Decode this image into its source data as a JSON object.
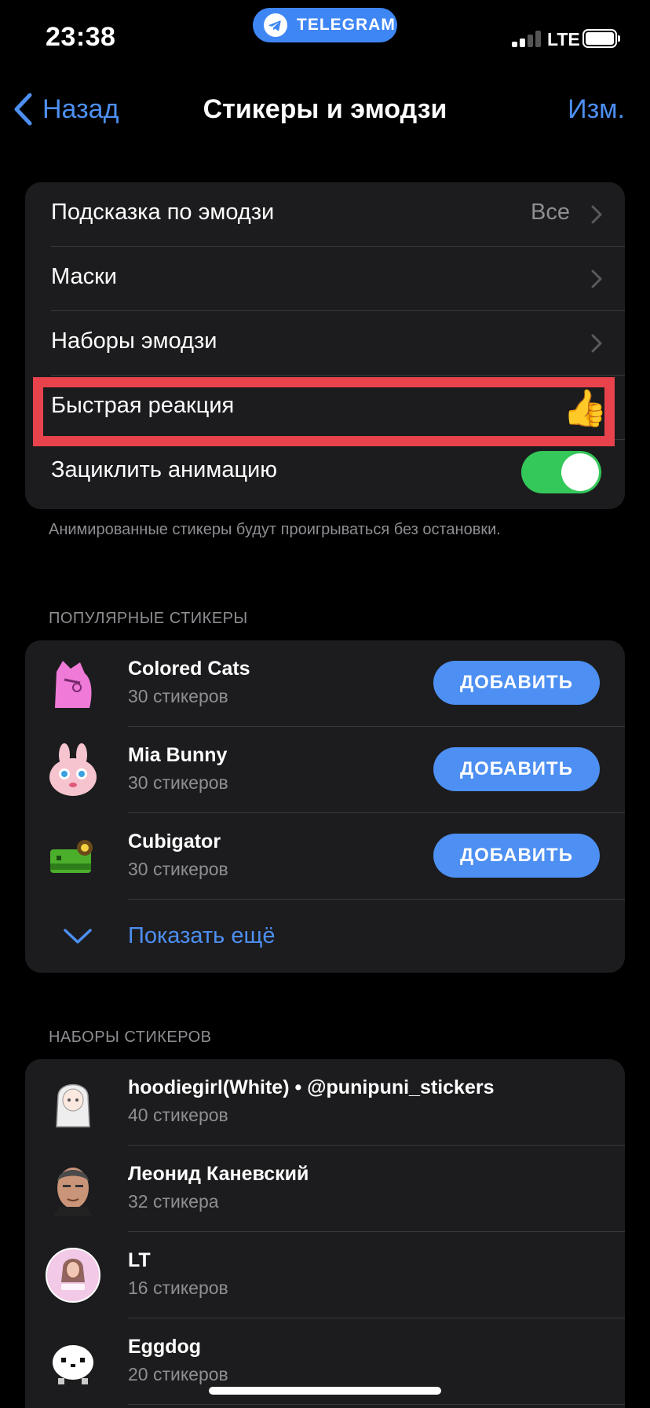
{
  "status_bar": {
    "time": "23:38",
    "carrier_pill": "TELEGRAM",
    "network": "LTE"
  },
  "nav": {
    "back_label": "Назад",
    "title": "Стикеры и эмодзи",
    "edit_label": "Изм."
  },
  "settings": {
    "rows": [
      {
        "label": "Подсказка по эмодзи",
        "value": "Все"
      },
      {
        "label": "Маски"
      },
      {
        "label": "Наборы эмодзи"
      },
      {
        "label": "Быстрая реакция",
        "emoji": "👍"
      },
      {
        "label": "Зациклить анимацию",
        "toggle_on": true
      }
    ],
    "footnote": "Анимированные стикеры будут проигрываться без остановки."
  },
  "popular": {
    "header": "ПОПУЛЯРНЫЕ СТИКЕРЫ",
    "items": [
      {
        "name": "Colored Cats",
        "count": "30 стикеров",
        "button": "ДОБАВИТЬ"
      },
      {
        "name": "Mia Bunny",
        "count": "30 стикеров",
        "button": "ДОБАВИТЬ"
      },
      {
        "name": "Cubigator",
        "count": "30 стикеров",
        "button": "ДОБАВИТЬ"
      }
    ],
    "show_more": "Показать ещё"
  },
  "sets": {
    "header": "НАБОРЫ СТИКЕРОВ",
    "items": [
      {
        "name": "hoodiegirl(White) • @punipuni_stickers",
        "count": "40 стикеров"
      },
      {
        "name": "Леонид Каневский",
        "count": "32 стикера"
      },
      {
        "name": "LT",
        "count": "16 стикеров"
      },
      {
        "name": "Eggdog",
        "count": "20 стикеров"
      }
    ]
  },
  "colors": {
    "accent": "#4d8ff2",
    "toggle_on": "#34c759",
    "highlight": "#e8434c",
    "cell_bg": "#1c1c1e"
  }
}
